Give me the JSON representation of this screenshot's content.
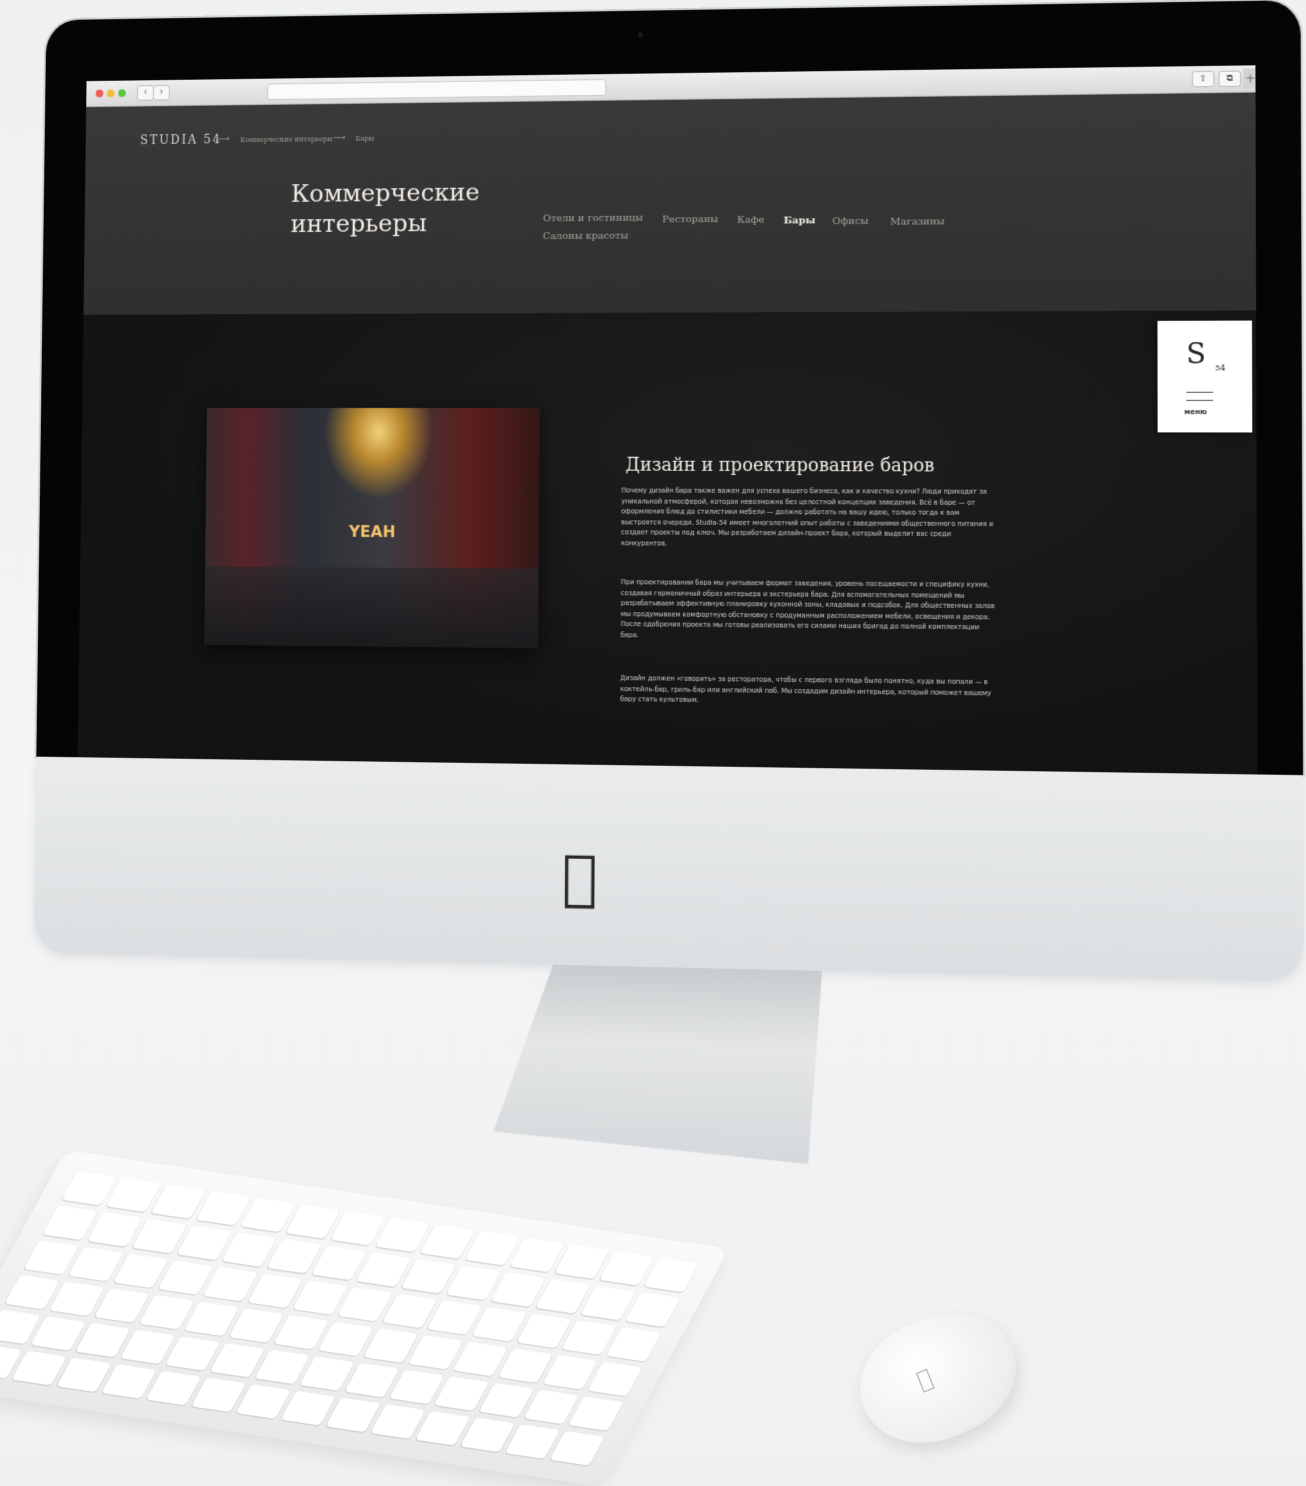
{
  "header": {
    "logo": "STUDIA 54",
    "breadcrumb": {
      "arrow": "⟶",
      "item_1": "Коммерческие интерьеры",
      "item_2": "Бары"
    },
    "page_title": "Коммерческие интерьеры",
    "menu": [
      {
        "label": "Отели и гостиницы",
        "active": false
      },
      {
        "label": "Рестораны",
        "active": false
      },
      {
        "label": "Кафе",
        "active": false
      },
      {
        "label": "Бары",
        "active": true
      },
      {
        "label": "Офисы",
        "active": false
      },
      {
        "label": "Магазины",
        "active": false
      },
      {
        "label": "Салоны красоты",
        "active": false
      }
    ]
  },
  "content": {
    "photo_sign": "YEAH",
    "title": "Дизайн и проектирование баров",
    "paragraphs": [
      "Почему дизайн бара также важен для успеха вашего бизнеса, как и качество кухни? Люди приходят за уникальной атмосферой, которая невозможна без целостной концепции заведения. Всё в баре — от оформления блюд до стилистики мебели — должно работать на вашу идею, только тогда к вам выстроятся очереди. Studia-54 имеет многолетний опыт работы с заведениями общественного питания и создает проекты под ключ. Мы разработаем дизайн-проект бара, который выделит вас среди конкурентов.",
      "При проектировании бара мы учитываем формат заведения, уровень посещаемости и специфику кухни, создавая гармоничный образ интерьера и экстерьера бара. Для вспомогательных помещений мы разрабатываем эффективную планировку кухонной зоны, кладовых и подсобок. Для общественных залов мы продумываем комфортную обстановку с продуманным расположением мебели, освещения и декора. После одобрения проекта мы готовы реализовать его силами наших бригад до полной комплектации бара.",
      "Дизайн должен «говорить» за ресторатора, чтобы с первого взгляда было понятно, куда вы попали — в коктейль-бар, гриль-бар или английский паб. Мы создадим дизайн интерьера, который поможет вашему бару стать культовым."
    ]
  },
  "side_menu": {
    "logo_letter": "S",
    "logo_sub": "54",
    "label": "меню"
  },
  "browser": {
    "back": "‹",
    "forward": "›",
    "share": "⇪",
    "tabs": "⧉",
    "new_tab": "+"
  },
  "colors": {
    "header_bg": "#343333",
    "content_bg": "#1a1919",
    "title_text": "#f0ece6",
    "menu_text": "#a8a39b",
    "side_menu_bg": "#ffffff"
  }
}
